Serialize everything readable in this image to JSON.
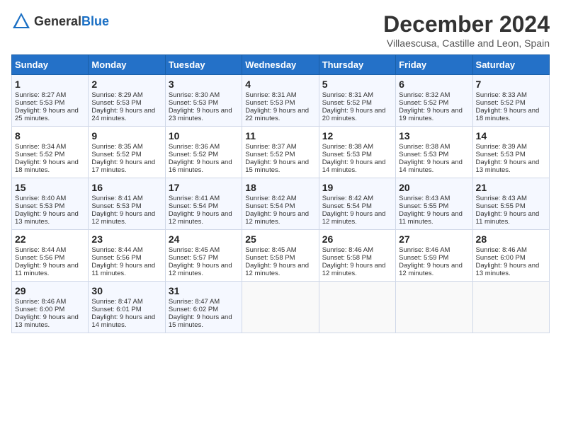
{
  "header": {
    "logo_general": "General",
    "logo_blue": "Blue",
    "month_title": "December 2024",
    "location": "Villaescusa, Castille and Leon, Spain"
  },
  "days_of_week": [
    "Sunday",
    "Monday",
    "Tuesday",
    "Wednesday",
    "Thursday",
    "Friday",
    "Saturday"
  ],
  "weeks": [
    [
      {
        "day": "1",
        "sunrise": "Sunrise: 8:27 AM",
        "sunset": "Sunset: 5:53 PM",
        "daylight": "Daylight: 9 hours and 25 minutes."
      },
      {
        "day": "2",
        "sunrise": "Sunrise: 8:29 AM",
        "sunset": "Sunset: 5:53 PM",
        "daylight": "Daylight: 9 hours and 24 minutes."
      },
      {
        "day": "3",
        "sunrise": "Sunrise: 8:30 AM",
        "sunset": "Sunset: 5:53 PM",
        "daylight": "Daylight: 9 hours and 23 minutes."
      },
      {
        "day": "4",
        "sunrise": "Sunrise: 8:31 AM",
        "sunset": "Sunset: 5:53 PM",
        "daylight": "Daylight: 9 hours and 22 minutes."
      },
      {
        "day": "5",
        "sunrise": "Sunrise: 8:31 AM",
        "sunset": "Sunset: 5:52 PM",
        "daylight": "Daylight: 9 hours and 20 minutes."
      },
      {
        "day": "6",
        "sunrise": "Sunrise: 8:32 AM",
        "sunset": "Sunset: 5:52 PM",
        "daylight": "Daylight: 9 hours and 19 minutes."
      },
      {
        "day": "7",
        "sunrise": "Sunrise: 8:33 AM",
        "sunset": "Sunset: 5:52 PM",
        "daylight": "Daylight: 9 hours and 18 minutes."
      }
    ],
    [
      {
        "day": "8",
        "sunrise": "Sunrise: 8:34 AM",
        "sunset": "Sunset: 5:52 PM",
        "daylight": "Daylight: 9 hours and 18 minutes."
      },
      {
        "day": "9",
        "sunrise": "Sunrise: 8:35 AM",
        "sunset": "Sunset: 5:52 PM",
        "daylight": "Daylight: 9 hours and 17 minutes."
      },
      {
        "day": "10",
        "sunrise": "Sunrise: 8:36 AM",
        "sunset": "Sunset: 5:52 PM",
        "daylight": "Daylight: 9 hours and 16 minutes."
      },
      {
        "day": "11",
        "sunrise": "Sunrise: 8:37 AM",
        "sunset": "Sunset: 5:52 PM",
        "daylight": "Daylight: 9 hours and 15 minutes."
      },
      {
        "day": "12",
        "sunrise": "Sunrise: 8:38 AM",
        "sunset": "Sunset: 5:53 PM",
        "daylight": "Daylight: 9 hours and 14 minutes."
      },
      {
        "day": "13",
        "sunrise": "Sunrise: 8:38 AM",
        "sunset": "Sunset: 5:53 PM",
        "daylight": "Daylight: 9 hours and 14 minutes."
      },
      {
        "day": "14",
        "sunrise": "Sunrise: 8:39 AM",
        "sunset": "Sunset: 5:53 PM",
        "daylight": "Daylight: 9 hours and 13 minutes."
      }
    ],
    [
      {
        "day": "15",
        "sunrise": "Sunrise: 8:40 AM",
        "sunset": "Sunset: 5:53 PM",
        "daylight": "Daylight: 9 hours and 13 minutes."
      },
      {
        "day": "16",
        "sunrise": "Sunrise: 8:41 AM",
        "sunset": "Sunset: 5:53 PM",
        "daylight": "Daylight: 9 hours and 12 minutes."
      },
      {
        "day": "17",
        "sunrise": "Sunrise: 8:41 AM",
        "sunset": "Sunset: 5:54 PM",
        "daylight": "Daylight: 9 hours and 12 minutes."
      },
      {
        "day": "18",
        "sunrise": "Sunrise: 8:42 AM",
        "sunset": "Sunset: 5:54 PM",
        "daylight": "Daylight: 9 hours and 12 minutes."
      },
      {
        "day": "19",
        "sunrise": "Sunrise: 8:42 AM",
        "sunset": "Sunset: 5:54 PM",
        "daylight": "Daylight: 9 hours and 12 minutes."
      },
      {
        "day": "20",
        "sunrise": "Sunrise: 8:43 AM",
        "sunset": "Sunset: 5:55 PM",
        "daylight": "Daylight: 9 hours and 11 minutes."
      },
      {
        "day": "21",
        "sunrise": "Sunrise: 8:43 AM",
        "sunset": "Sunset: 5:55 PM",
        "daylight": "Daylight: 9 hours and 11 minutes."
      }
    ],
    [
      {
        "day": "22",
        "sunrise": "Sunrise: 8:44 AM",
        "sunset": "Sunset: 5:56 PM",
        "daylight": "Daylight: 9 hours and 11 minutes."
      },
      {
        "day": "23",
        "sunrise": "Sunrise: 8:44 AM",
        "sunset": "Sunset: 5:56 PM",
        "daylight": "Daylight: 9 hours and 11 minutes."
      },
      {
        "day": "24",
        "sunrise": "Sunrise: 8:45 AM",
        "sunset": "Sunset: 5:57 PM",
        "daylight": "Daylight: 9 hours and 12 minutes."
      },
      {
        "day": "25",
        "sunrise": "Sunrise: 8:45 AM",
        "sunset": "Sunset: 5:58 PM",
        "daylight": "Daylight: 9 hours and 12 minutes."
      },
      {
        "day": "26",
        "sunrise": "Sunrise: 8:46 AM",
        "sunset": "Sunset: 5:58 PM",
        "daylight": "Daylight: 9 hours and 12 minutes."
      },
      {
        "day": "27",
        "sunrise": "Sunrise: 8:46 AM",
        "sunset": "Sunset: 5:59 PM",
        "daylight": "Daylight: 9 hours and 12 minutes."
      },
      {
        "day": "28",
        "sunrise": "Sunrise: 8:46 AM",
        "sunset": "Sunset: 6:00 PM",
        "daylight": "Daylight: 9 hours and 13 minutes."
      }
    ],
    [
      {
        "day": "29",
        "sunrise": "Sunrise: 8:46 AM",
        "sunset": "Sunset: 6:00 PM",
        "daylight": "Daylight: 9 hours and 13 minutes."
      },
      {
        "day": "30",
        "sunrise": "Sunrise: 8:47 AM",
        "sunset": "Sunset: 6:01 PM",
        "daylight": "Daylight: 9 hours and 14 minutes."
      },
      {
        "day": "31",
        "sunrise": "Sunrise: 8:47 AM",
        "sunset": "Sunset: 6:02 PM",
        "daylight": "Daylight: 9 hours and 15 minutes."
      },
      null,
      null,
      null,
      null
    ]
  ]
}
